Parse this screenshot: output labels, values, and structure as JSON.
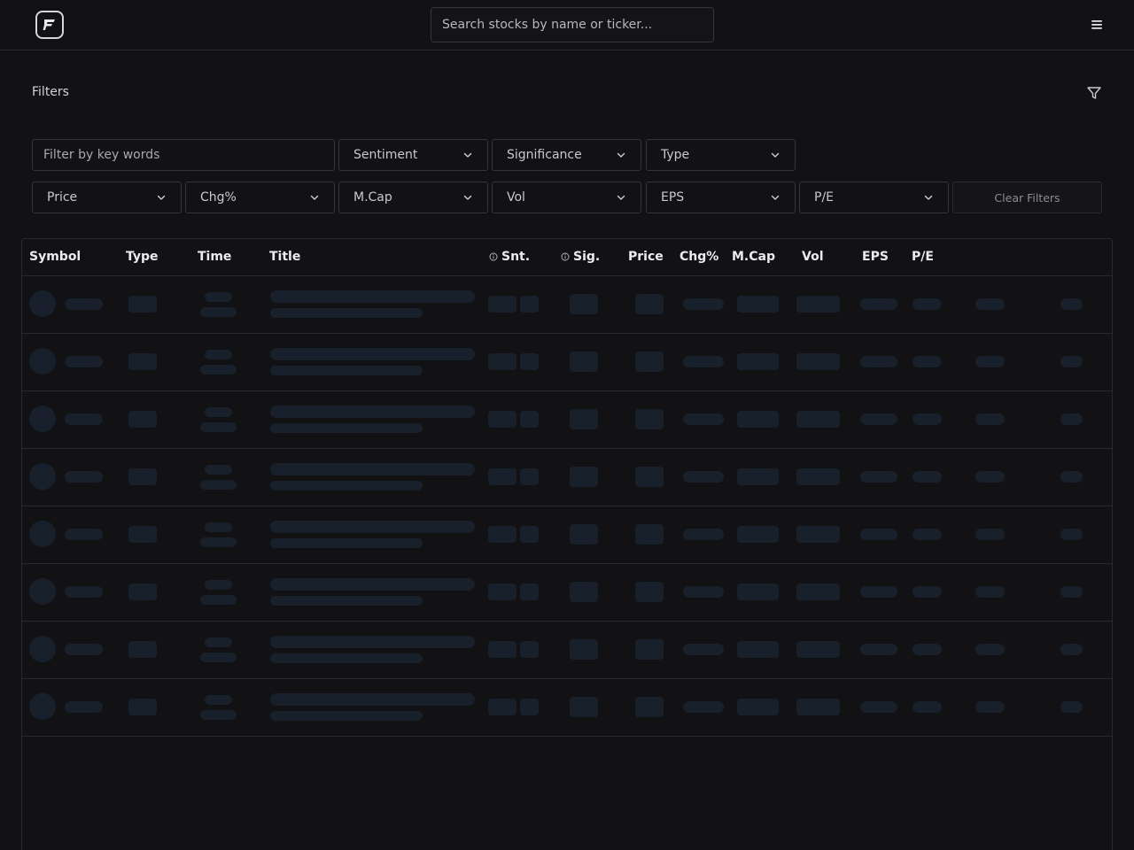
{
  "header": {
    "logo_icon": "logo-icon",
    "search_placeholder": "Search stocks by name or ticker...",
    "menu_icon": "hamburger-menu-icon"
  },
  "filters": {
    "title": "Filters",
    "keyword_placeholder": "Filter by key words",
    "dropdowns_row1": [
      "Sentiment",
      "Significance",
      "Type"
    ],
    "dropdowns_row2": [
      "Price",
      "Chg%",
      "M.Cap",
      "Vol",
      "EPS",
      "P/E"
    ],
    "clear_label": "Clear Filters"
  },
  "table": {
    "columns": [
      {
        "label": "Symbol"
      },
      {
        "label": "Type"
      },
      {
        "label": "Time"
      },
      {
        "label": "Title"
      },
      {
        "label": "Snt.",
        "icon": "info-circle-icon"
      },
      {
        "label": "Sig.",
        "icon": "info-circle-icon"
      },
      {
        "label": "Price"
      },
      {
        "label": "Chg%"
      },
      {
        "label": "M.Cap"
      },
      {
        "label": "Vol"
      },
      {
        "label": "EPS"
      },
      {
        "label": "P/E"
      }
    ],
    "loading_rows": 8
  },
  "colors": {
    "background": "#121113",
    "border": "#2a2a2e",
    "skeleton": "#18202b",
    "text": "#e6e6e8"
  }
}
